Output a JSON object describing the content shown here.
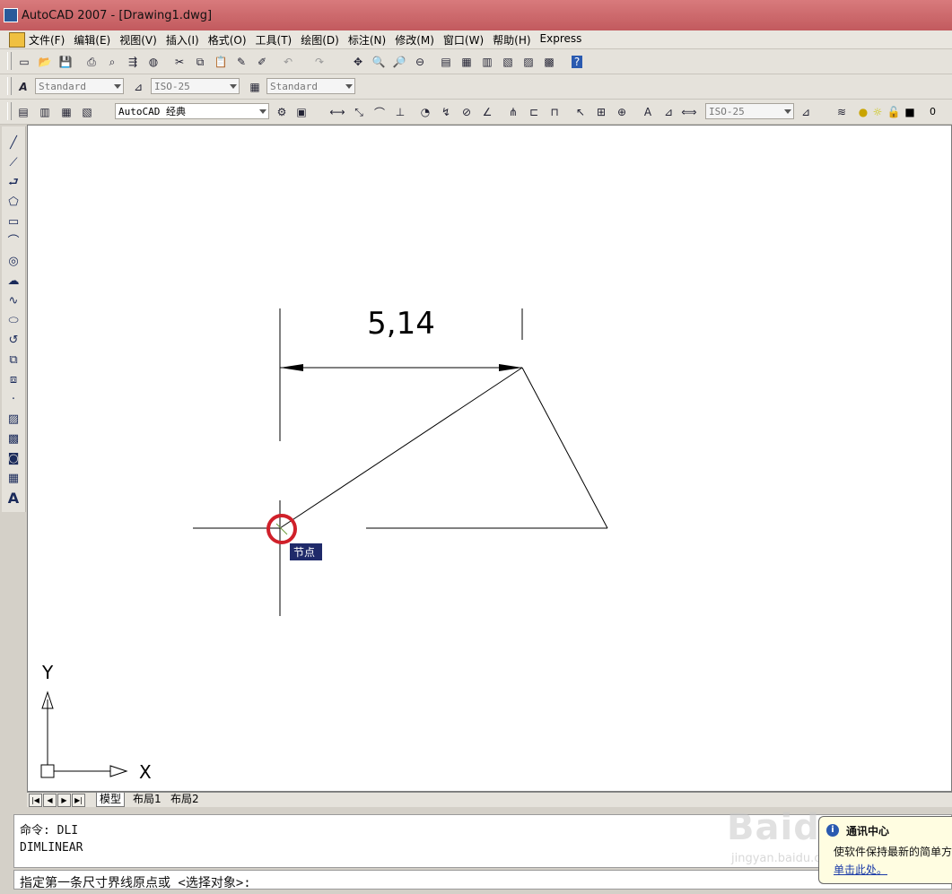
{
  "window": {
    "title": "AutoCAD 2007 - [Drawing1.dwg]"
  },
  "menu": [
    "文件(F)",
    "编辑(E)",
    "视图(V)",
    "插入(I)",
    "格式(O)",
    "工具(T)",
    "绘图(D)",
    "标注(N)",
    "修改(M)",
    "窗口(W)",
    "帮助(H)",
    "Express"
  ],
  "styles_toolbar": {
    "text_style": "Standard",
    "dim_style": "ISO-25",
    "table_style": "Standard"
  },
  "workspace_toolbar": {
    "workspace": "AutoCAD 经典",
    "dim_style": "ISO-25",
    "layer": "0"
  },
  "drawing": {
    "dimension_text": "5,14",
    "osnap_tooltip": "节点",
    "ucs_x": "X",
    "ucs_y": "Y",
    "snap_marker_color": "#d0202a"
  },
  "layout_tabs": [
    "模型",
    "布局1",
    "布局2"
  ],
  "command": {
    "history": [
      "命令: DLI",
      "DIMLINEAR"
    ],
    "prompt": "指定第一条尺寸界线原点或 <选择对象>:"
  },
  "balloon": {
    "title": "通讯中心",
    "body": "使软件保持最新的简单方",
    "link": "单击此处。"
  },
  "watermark": {
    "text": "Baidu",
    "sub": "jingyan.baidu.com"
  }
}
